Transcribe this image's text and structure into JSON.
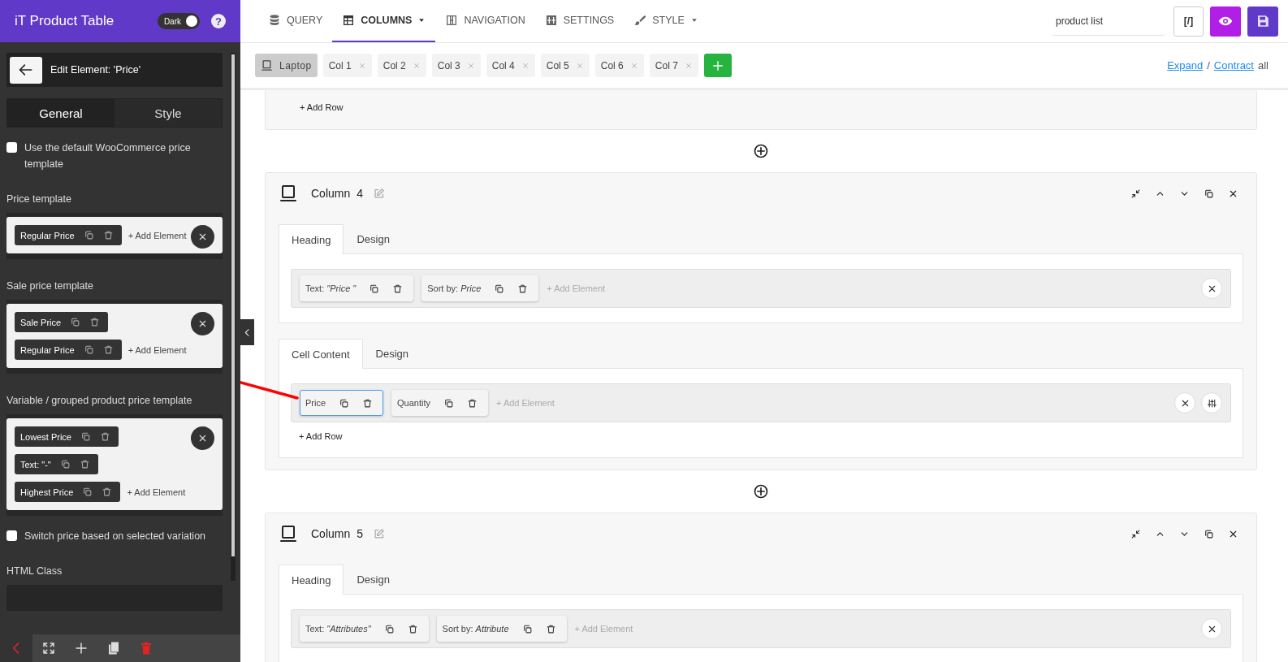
{
  "sidebar": {
    "title": "iT Product Table",
    "theme_toggle": {
      "label": "Dark",
      "on": true
    },
    "help": "?",
    "editor": {
      "title": "Edit Element: 'Price'",
      "tabs": [
        {
          "label": "General",
          "selected": true
        },
        {
          "label": "Style",
          "selected": false
        }
      ],
      "fields": [
        {
          "kind": "checkbox",
          "label": "Use the default WooCommerce price template",
          "checked": false
        },
        {
          "kind": "template",
          "label": "Price template",
          "rows": [
            {
              "elements": [
                "Regular Price"
              ],
              "add_element": "+ Add Element"
            }
          ]
        },
        {
          "kind": "template",
          "label": "Sale price template",
          "rows": [
            {
              "elements": [
                "Sale Price"
              ]
            },
            {
              "elements": [
                "Regular Price"
              ],
              "add_element": "+ Add Element"
            }
          ]
        },
        {
          "kind": "template",
          "label": "Variable / grouped product price template",
          "rows": [
            {
              "elements": [
                "Lowest Price"
              ]
            },
            {
              "elements": [
                "Text: \"-\""
              ]
            },
            {
              "elements": [
                "Highest Price"
              ],
              "add_element": "+ Add Element"
            }
          ]
        },
        {
          "kind": "checkbox",
          "label": "Switch price based on selected variation",
          "checked": false
        },
        {
          "kind": "text",
          "label": "HTML Class"
        }
      ]
    }
  },
  "main": {
    "nav": {
      "tabs": [
        {
          "label": "QUERY",
          "selected": false,
          "dropdown": false
        },
        {
          "label": "COLUMNS",
          "selected": true,
          "dropdown": true
        },
        {
          "label": "NAVIGATION",
          "selected": false,
          "dropdown": false
        },
        {
          "label": "SETTINGS",
          "selected": false,
          "dropdown": false
        },
        {
          "label": "STYLE",
          "selected": false,
          "dropdown": true
        }
      ],
      "search": {
        "value": "product list"
      },
      "code_button": "[/]"
    },
    "device_bar": {
      "device": {
        "label": "Laptop",
        "selected": true
      },
      "columns": [
        "Col 1",
        "Col 2",
        "Col 3",
        "Col 4",
        "Col 5",
        "Col 6",
        "Col 7"
      ],
      "expand": "Expand",
      "separator": "/",
      "contract": "Contract",
      "suffix": "all"
    },
    "columns": [
      {
        "kind": "partial",
        "add_row": "+ Add Row"
      },
      {
        "kind": "column",
        "title": "Column",
        "number": "4",
        "sections": [
          {
            "tabs": [
              {
                "label": "Heading",
                "selected": true
              },
              {
                "label": "Design",
                "selected": false
              }
            ],
            "settings": false,
            "rows": [
              {
                "elements": [
                  {
                    "label": "Text: *\"Price \"*",
                    "selected": false
                  },
                  {
                    "label": "Sort by: *Price*",
                    "selected": false
                  }
                ],
                "add_element": "+ Add Element"
              }
            ]
          },
          {
            "tabs": [
              {
                "label": "Cell Content",
                "selected": true
              },
              {
                "label": "Design",
                "selected": false
              }
            ],
            "settings": true,
            "add_row": "+ Add Row",
            "rows": [
              {
                "elements": [
                  {
                    "label": "Price",
                    "selected": true
                  },
                  {
                    "label": "Quantity",
                    "selected": false
                  }
                ],
                "add_element": "+ Add Element"
              }
            ]
          }
        ]
      },
      {
        "kind": "column",
        "title": "Column",
        "number": "5",
        "sections": [
          {
            "tabs": [
              {
                "label": "Heading",
                "selected": true
              },
              {
                "label": "Design",
                "selected": false
              }
            ],
            "settings": false,
            "rows": [
              {
                "elements": [
                  {
                    "label": "Text: *\"Attributes\"*",
                    "selected": false
                  },
                  {
                    "label": "Sort by: *Attribute*",
                    "selected": false
                  }
                ],
                "add_element": "+ Add Element"
              }
            ]
          }
        ]
      }
    ]
  }
}
